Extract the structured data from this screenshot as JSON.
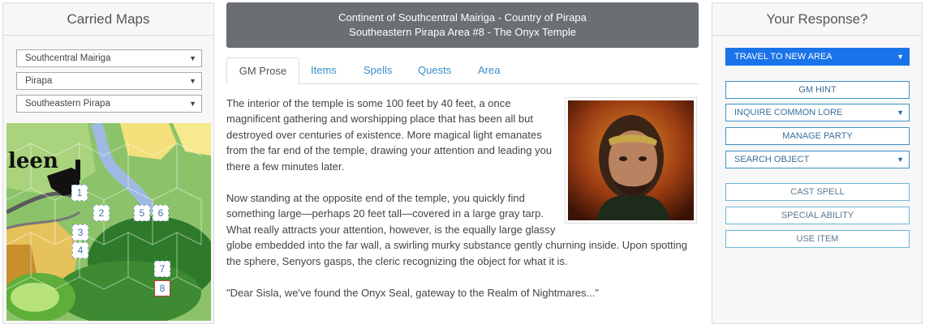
{
  "left": {
    "title": "Carried Maps",
    "selects": [
      "Southcentral Mairiga",
      "Pirapa",
      "Southeastern Pirapa"
    ],
    "map_text": "leen",
    "map_labels": [
      "1",
      "2",
      "3",
      "4",
      "5",
      "6",
      "7",
      "8"
    ]
  },
  "center": {
    "header_line1": "Continent of Southcentral Mairiga - Country of Pirapa",
    "header_line2": "Southeastern Pirapa Area #8 - The Onyx Temple",
    "tabs": [
      "GM Prose",
      "Items",
      "Spells",
      "Quests",
      "Area"
    ],
    "paragraphs": [
      "The interior of the temple is some 100 feet by 40 feet, a once magnificent gathering and worshipping place that has been all but destroyed over centuries of existence. More magical light emanates from the far end of the temple, drawing your attention and leading you there a few minutes later.",
      "Now standing at the opposite end of the temple, you quickly find something large—perhaps 20 feet tall—covered in a large gray tarp. What really attracts your attention, however, is the equally large glassy globe embedded into the far wall, a swirling murky substance gently churning inside. Upon spotting the sphere, Senyors gasps, the cleric recognizing the object for what it is.",
      "\"Dear Sisla, we've found the Onyx Seal, gateway to the Realm of Nightmares...\""
    ]
  },
  "right": {
    "title": "Your Response?",
    "actions": [
      "TRAVEL TO NEW AREA",
      "GM HINT",
      "INQUIRE COMMON LORE",
      "MANAGE PARTY",
      "SEARCH OBJECT",
      "CAST SPELL",
      "SPECIAL ABILITY",
      "USE ITEM"
    ]
  },
  "colors": {
    "accent": "#1a73e8",
    "link": "#3a8fc9",
    "header": "#6b6e72"
  }
}
